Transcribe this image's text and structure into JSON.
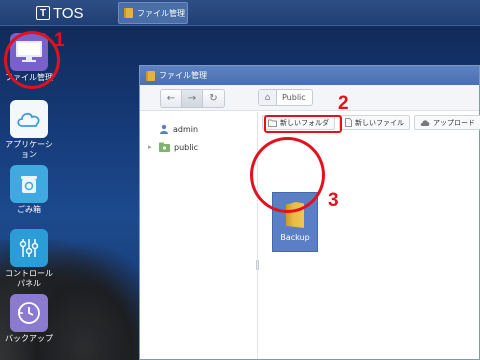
{
  "taskbar": {
    "logo_text": "TOS",
    "logo_mark": "T",
    "open_app": "ファイル管理"
  },
  "desktop": {
    "icons": [
      {
        "label": "ファイル管理",
        "icon": "file-manager-icon"
      },
      {
        "label": "アプリケーション",
        "icon": "app-center-icon"
      },
      {
        "label": "ごみ箱",
        "icon": "trash-icon"
      },
      {
        "label": "コントロールパネル",
        "icon": "control-panel-icon"
      },
      {
        "label": "バックアップ",
        "icon": "backup-icon"
      }
    ]
  },
  "window": {
    "title": "ファイル管理",
    "breadcrumb": "Public",
    "sidebar": [
      {
        "label": "admin",
        "icon": "user-icon"
      },
      {
        "label": "public",
        "icon": "shared-folder-icon"
      }
    ],
    "actions": [
      "新しいフォルダ",
      "新しいファイル",
      "アップロード"
    ],
    "files": [
      {
        "name": "Backup",
        "type": "folder",
        "selected": true
      }
    ]
  },
  "annotations": {
    "step1": "1",
    "step2": "2",
    "step3": "3",
    "color": "#e4101c"
  }
}
